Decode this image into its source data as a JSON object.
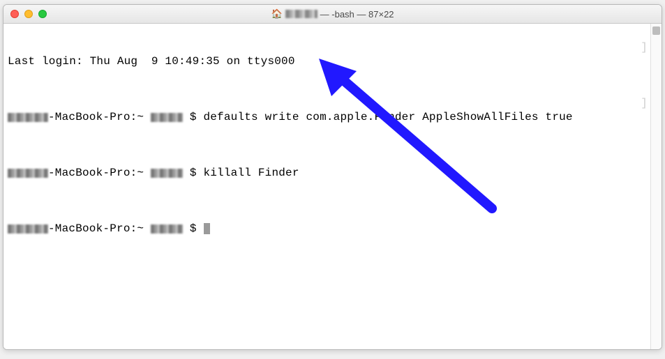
{
  "window": {
    "title_suffix": " — -bash — 87×22"
  },
  "terminal": {
    "last_login": "Last login: Thu Aug  9 10:49:35 on ttys000",
    "host_suffix": "-MacBook-Pro:~ ",
    "prompt_symbol": " $ ",
    "lines": [
      {
        "cmd": "defaults write com.apple.Finder AppleShowAllFiles true"
      },
      {
        "cmd": "killall Finder"
      },
      {
        "cmd": ""
      }
    ]
  },
  "colors": {
    "arrow": "#2118ff"
  }
}
